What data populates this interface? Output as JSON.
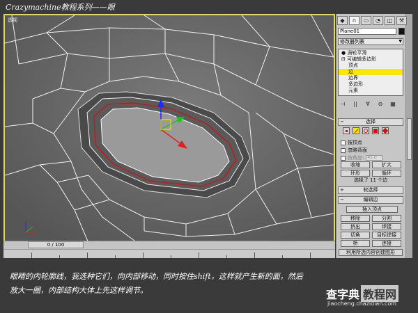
{
  "header": {
    "title": "Crazymachine教程系列——眼"
  },
  "viewport": {
    "label": "透视"
  },
  "timeline": {
    "frame_counter": "0 / 100"
  },
  "panel": {
    "tabs": [
      "◆",
      "∩",
      "▭",
      "◔",
      "◫",
      "⚒"
    ],
    "object_name": "Plane01",
    "modifier_list": "修改器列表",
    "stack": {
      "items": [
        "涡轮平滑",
        "可编辑多边形",
        "顶点",
        "边",
        "边界",
        "多边形",
        "元素"
      ],
      "selected_index": 3
    },
    "tools": [
      "⊣",
      "||",
      "∀",
      "⊖",
      "▦"
    ],
    "selection_rollout": "选择",
    "by_vertex": "按顶点",
    "ignore_backfacing": "忽略背面",
    "by_angle": "按角度:",
    "angle_value": "45.0",
    "shrink": "收缩",
    "grow": "扩大",
    "ring": "环形",
    "loop": "循环",
    "selection_count": "选择了 11 个边",
    "soft_selection": "软选择",
    "edit_edges": "编辑边",
    "insert_vertex": "插入顶点",
    "remove": "移除",
    "split": "分割",
    "extrude": "挤出",
    "weld": "焊接",
    "chamfer": "切角",
    "target_weld": "目标焊接",
    "bridge": "桥",
    "connect": "连接",
    "create_shape": "利用所选内容创建图形"
  },
  "caption": {
    "line1": "眼睛的内轮廓线，我选种它们，向内部移动，同时按住shift，这样就产生新的面，然后",
    "line2": "放大一圈，内部结构大体上先这样调节。"
  },
  "watermark": {
    "main": "查字典",
    "badge": "教程网",
    "url": "jiaocheng.chazidian.com"
  },
  "colors": {
    "viewport_border": "#e2dc4c",
    "selected_edge": "#ffe600",
    "selection_highlight": "#d01010"
  }
}
